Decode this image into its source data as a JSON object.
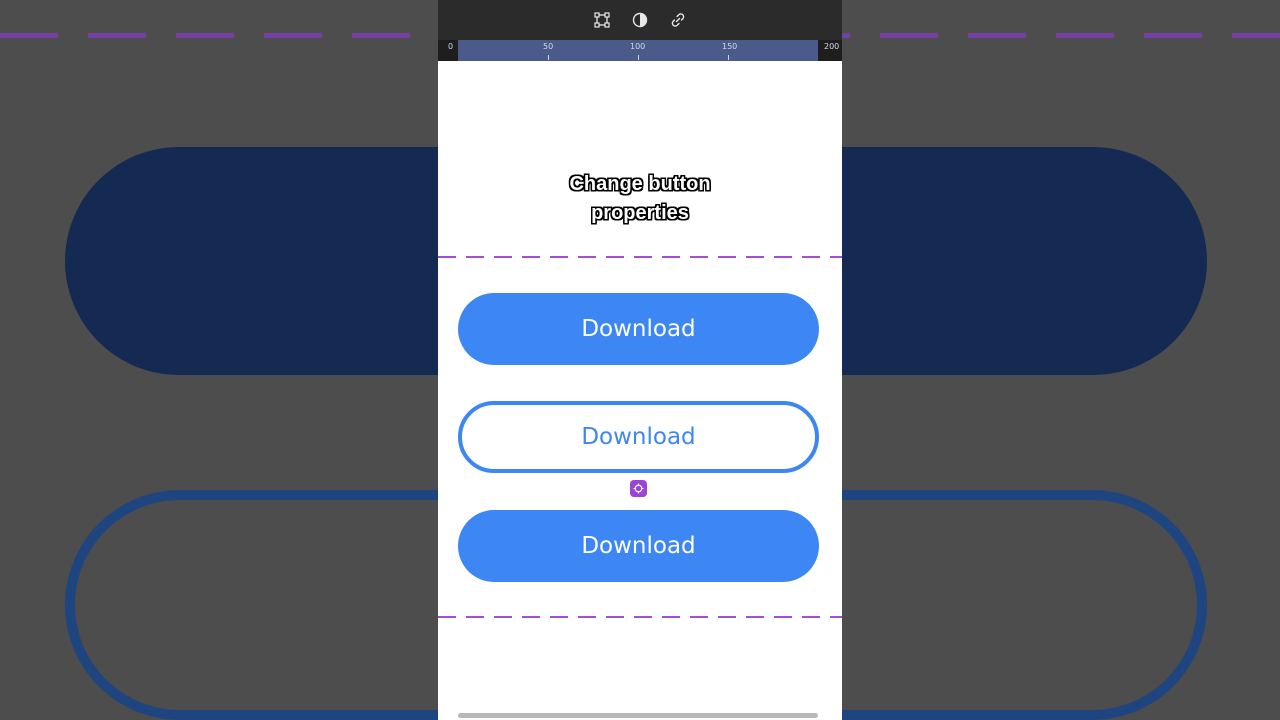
{
  "toolbar": {
    "icons": [
      "frame-select-icon",
      "contrast-icon",
      "link-icon"
    ]
  },
  "ruler": {
    "labels": [
      "0",
      "50",
      "100",
      "150",
      "200"
    ]
  },
  "caption": {
    "line1": "Change button",
    "line2": "properties"
  },
  "buttons": [
    {
      "label": "Download",
      "style": "filled"
    },
    {
      "label": "Download",
      "style": "outline"
    },
    {
      "label": "Download",
      "style": "filled"
    }
  ],
  "colors": {
    "accent": "#3c87f4",
    "guide": "#a24fd6",
    "gap_handle": "#9b45d6"
  }
}
